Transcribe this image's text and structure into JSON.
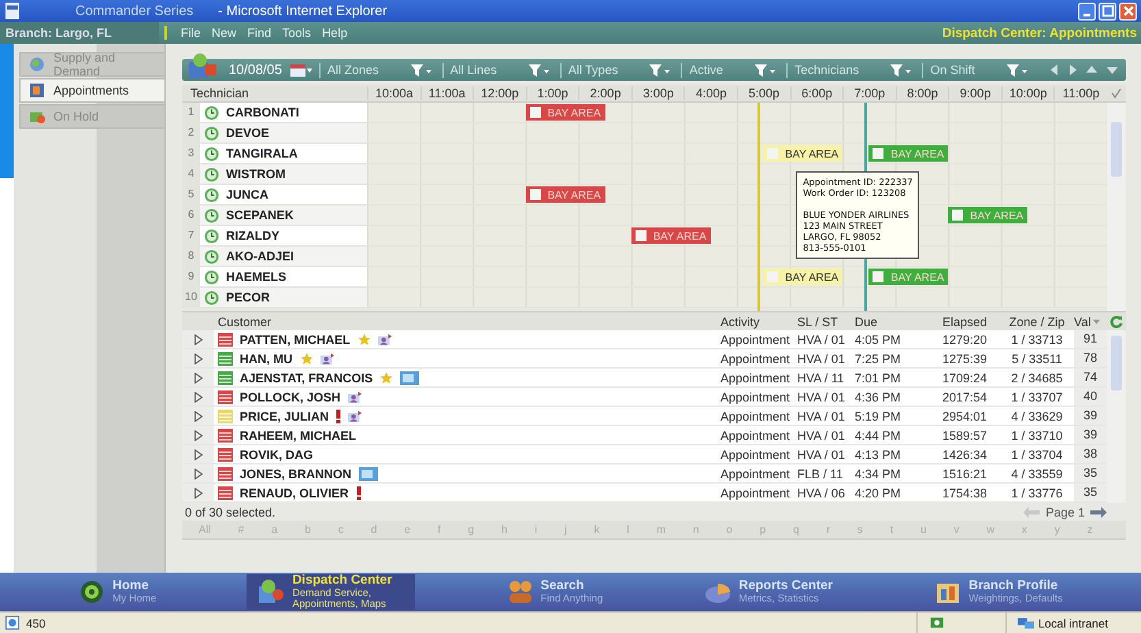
{
  "window": {
    "title": "Commander Series",
    "app": "- Microsoft Internet Explorer"
  },
  "menubar": {
    "branch": "Branch: Largo, FL",
    "items": [
      "File",
      "New",
      "Find",
      "Tools",
      "Help"
    ],
    "page_title": "Dispatch Center: Appointments"
  },
  "sidebar": {
    "items": [
      {
        "label": "Supply and Demand",
        "selected": false
      },
      {
        "label": "Appointments",
        "selected": true
      },
      {
        "label": "On Hold",
        "selected": false
      }
    ]
  },
  "toolbar": {
    "date": "10/08/05",
    "filters": [
      "All Zones",
      "All Lines",
      "All Types",
      "Active",
      "Technicians",
      "On Shift"
    ]
  },
  "schedule": {
    "header": "Technician",
    "hours": [
      "10:00a",
      "11:00a",
      "12:00p",
      "1:00p",
      "2:00p",
      "3:00p",
      "4:00p",
      "5:00p",
      "6:00p",
      "7:00p",
      "8:00p",
      "9:00p",
      "10:00p",
      "11:00p"
    ],
    "markers": [
      {
        "color": "#d6c83a"
      },
      {
        "color": "#4aa8a0"
      }
    ],
    "technicians": [
      {
        "number": "1",
        "name": "CARBONATI",
        "blocks": [
          {
            "label": "BAY AREA",
            "color": "#d94848"
          }
        ]
      },
      {
        "number": "2",
        "name": "DEVOE"
      },
      {
        "number": "3",
        "name": "TANGIRALA",
        "blocks": [
          {
            "label": "BAY AREA",
            "color": "#f6f2a8"
          },
          {
            "label": "BAY AREA",
            "color": "#3fae3f"
          }
        ]
      },
      {
        "number": "4",
        "name": "WISTROM"
      },
      {
        "number": "5",
        "name": "JUNCA",
        "blocks": [
          {
            "label": "BAY AREA",
            "color": "#d94848"
          }
        ]
      },
      {
        "number": "6",
        "name": "SCEPANEK",
        "blocks": [
          {
            "label": "BAY AREA",
            "color": "#3fae3f"
          }
        ]
      },
      {
        "number": "7",
        "name": "RIZALDY",
        "blocks": [
          {
            "label": "BAY AREA",
            "color": "#d94848"
          }
        ]
      },
      {
        "number": "8",
        "name": "AKO-ADJEI"
      },
      {
        "number": "9",
        "name": "HAEMELS",
        "blocks": [
          {
            "label": "BAY AREA",
            "color": "#f6f2a8"
          },
          {
            "label": "BAY AREA",
            "color": "#3fae3f"
          }
        ]
      },
      {
        "number": "10",
        "name": "PECOR"
      }
    ],
    "tooltip": {
      "lines": [
        "Appointment ID: 222337",
        "Work Order ID: 123208"
      ],
      "address": [
        "BLUE YONDER AIRLINES",
        "123 MAIN STREET",
        "LARGO, FL 98052",
        "813-555-0101"
      ]
    }
  },
  "customers": {
    "columns": [
      "Customer",
      "Activity",
      "SL / ST",
      "Due",
      "Elapsed",
      "Zone / Zip",
      "Val"
    ],
    "rows": [
      {
        "name": "PATTEN, MICHAEL",
        "color": "#d84848",
        "starred": true,
        "flagged": false,
        "contact": true,
        "document": false,
        "activity": "Appointment",
        "sl_st": "HVA / 01",
        "due": "4:05 PM",
        "elapsed": "1279:20",
        "zone_zip": "1 / 33713",
        "val": "91"
      },
      {
        "name": "HAN, MU",
        "color": "#48a848",
        "starred": true,
        "flagged": false,
        "contact": true,
        "document": false,
        "activity": "Appointment",
        "sl_st": "HVA / 01",
        "due": "7:25 PM",
        "elapsed": "1275:39",
        "zone_zip": "5 / 33511",
        "val": "78"
      },
      {
        "name": "AJENSTAT, FRANCOIS",
        "color": "#48a848",
        "starred": true,
        "flagged": false,
        "contact": false,
        "document": true,
        "activity": "Appointment",
        "sl_st": "HVA / 11",
        "due": "7:01 PM",
        "elapsed": "1709:24",
        "zone_zip": "2 / 34685",
        "val": "74"
      },
      {
        "name": "POLLOCK, JOSH",
        "color": "#d84848",
        "starred": false,
        "flagged": false,
        "contact": true,
        "document": false,
        "activity": "Appointment",
        "sl_st": "HVA / 01",
        "due": "4:36 PM",
        "elapsed": "2017:54",
        "zone_zip": "1 / 33707",
        "val": "40"
      },
      {
        "name": "PRICE, JULIAN",
        "color": "#e8d870",
        "starred": false,
        "flagged": true,
        "contact": true,
        "document": false,
        "activity": "Appointment",
        "sl_st": "HVA / 01",
        "due": "5:19 PM",
        "elapsed": "2954:01",
        "zone_zip": "4 / 33629",
        "val": "39"
      },
      {
        "name": "RAHEEM, MICHAEL",
        "color": "#d84848",
        "starred": false,
        "flagged": false,
        "contact": false,
        "document": false,
        "activity": "Appointment",
        "sl_st": "HVA / 01",
        "due": "4:44 PM",
        "elapsed": "1589:57",
        "zone_zip": "1 / 33710",
        "val": "39"
      },
      {
        "name": "ROVIK, DAG",
        "color": "#d84848",
        "starred": false,
        "flagged": false,
        "contact": false,
        "document": false,
        "activity": "Appointment",
        "sl_st": "HVA / 01",
        "due": "4:13 PM",
        "elapsed": "1426:34",
        "zone_zip": "1 / 33704",
        "val": "38"
      },
      {
        "name": "JONES, BRANNON",
        "color": "#d84848",
        "starred": false,
        "flagged": false,
        "contact": false,
        "document": true,
        "activity": "Appointment",
        "sl_st": "FLB / 11",
        "due": "4:34 PM",
        "elapsed": "1516:21",
        "zone_zip": "4 / 33559",
        "val": "35"
      },
      {
        "name": "RENAUD, OLIVIER",
        "color": "#d84848",
        "starred": false,
        "flagged": true,
        "contact": false,
        "document": false,
        "activity": "Appointment",
        "sl_st": "HVA / 06",
        "due": "4:20 PM",
        "elapsed": "1754:38",
        "zone_zip": "1 / 33776",
        "val": "35"
      }
    ],
    "selection": "0 of 30 selected.",
    "page": "Page 1"
  },
  "alphabet": [
    "All",
    "#",
    "a",
    "b",
    "c",
    "d",
    "e",
    "f",
    "g",
    "h",
    "i",
    "j",
    "k",
    "l",
    "m",
    "n",
    "o",
    "p",
    "q",
    "r",
    "s",
    "t",
    "u",
    "v",
    "w",
    "x",
    "y",
    "z"
  ],
  "navbar": [
    {
      "title": "Home",
      "subtitle": "My Home",
      "selected": false
    },
    {
      "title": "Dispatch Center",
      "subtitle": "Demand Service, Appointments, Maps",
      "selected": true
    },
    {
      "title": "Search",
      "subtitle": "Find Anything",
      "selected": false
    },
    {
      "title": "Reports Center",
      "subtitle": "Metrics, Statistics",
      "selected": false
    },
    {
      "title": "Branch Profile",
      "subtitle": "Weightings, Defaults",
      "selected": false
    }
  ],
  "status_bar": {
    "text": "450",
    "zone": "Local intranet"
  }
}
